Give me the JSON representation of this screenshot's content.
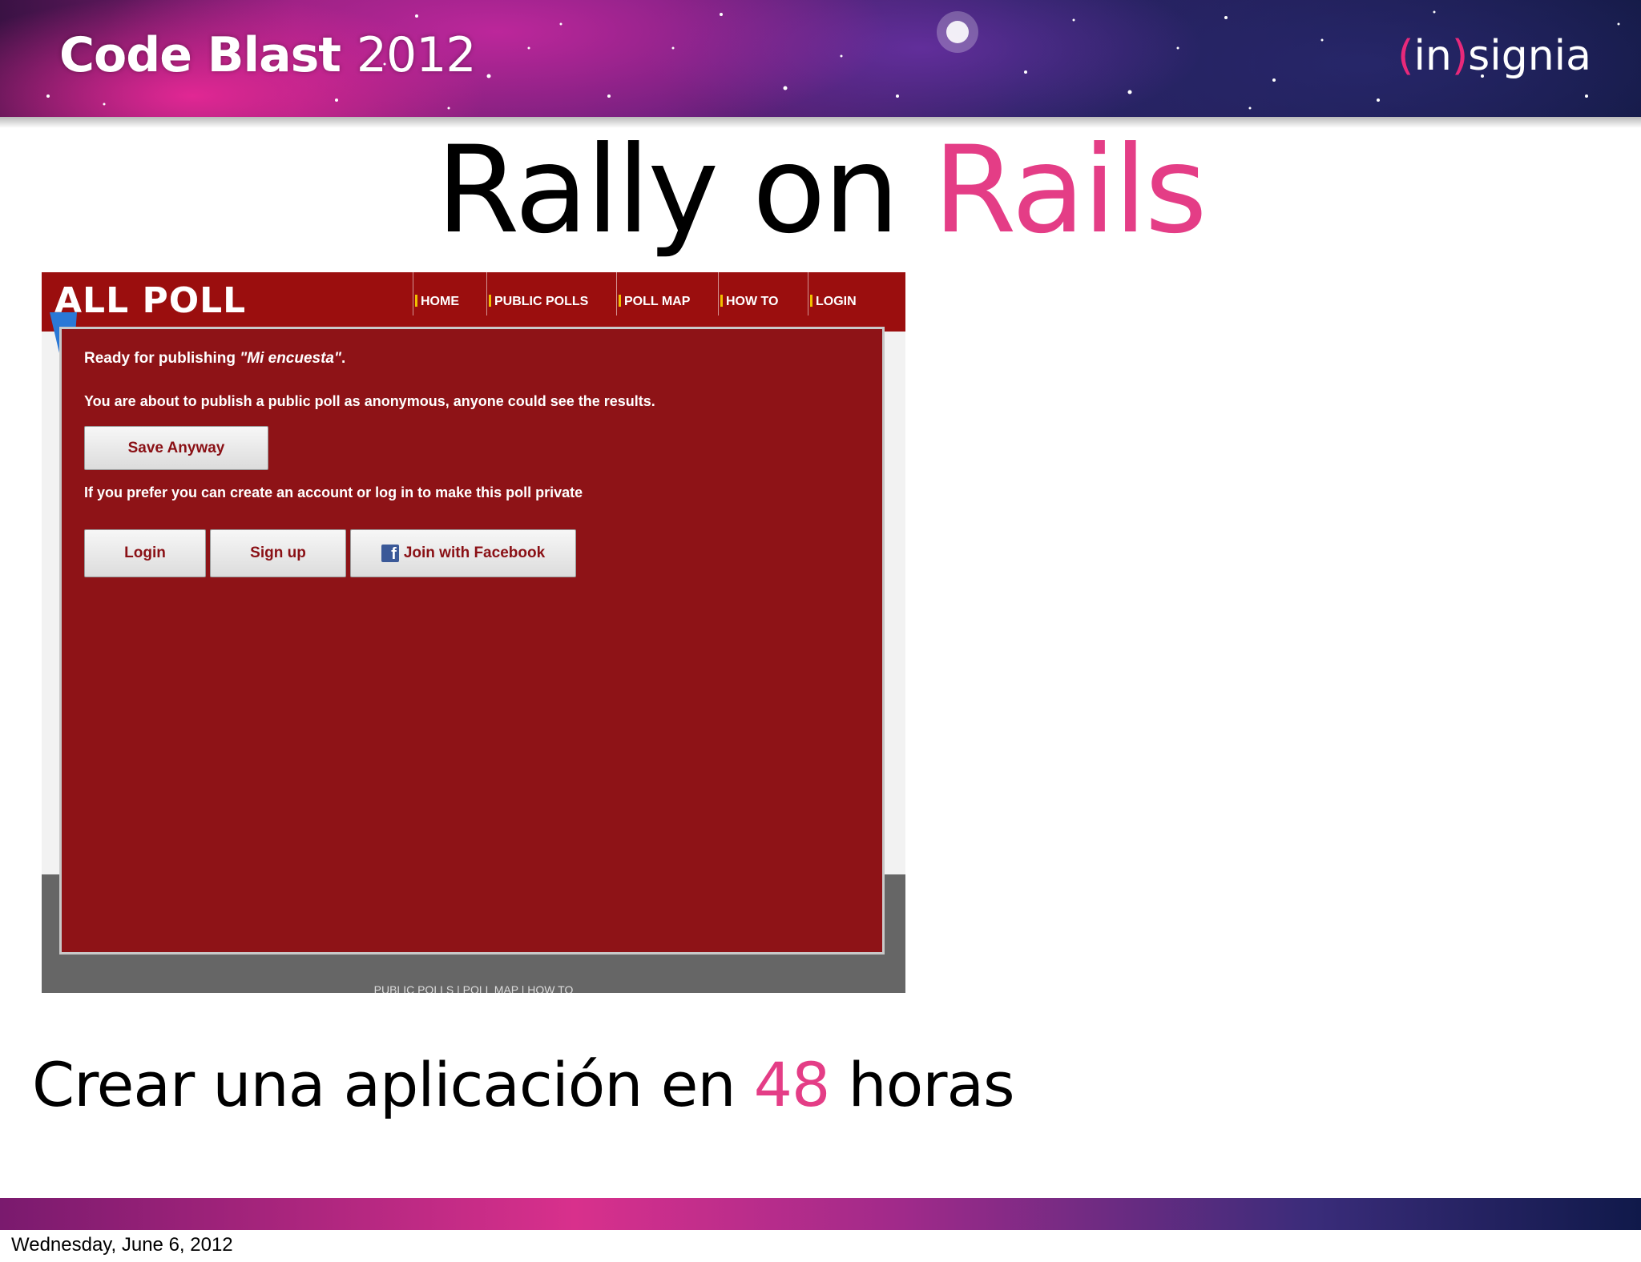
{
  "banner": {
    "title": "Code Blast",
    "year": "2012",
    "logo_paren_open": "(",
    "logo_in": "in",
    "logo_paren_close": ")",
    "logo_rest": "signia"
  },
  "slide": {
    "title_part1": "Rally on ",
    "title_part2": "Rails"
  },
  "app": {
    "logo": "ALL POLL",
    "nav": [
      "HOME",
      "PUBLIC POLLS",
      "POLL MAP",
      "HOW TO",
      "LOGIN"
    ],
    "ready_prefix": "Ready for publishing ",
    "poll_name": "\"Mi encuesta\"",
    "ready_suffix": ".",
    "anonymous_warning": "You are about to publish a public poll as anonymous, anyone could see the results.",
    "save_anyway_label": "Save Anyway",
    "private_hint": "If you prefer you can create an account or log in to make this poll private",
    "login_label": "Login",
    "signup_label": "Sign up",
    "facebook_label": "Join with Facebook",
    "footer_links": "PUBLIC POLLS | POLL MAP | HOW TO"
  },
  "caption": {
    "part1": "Crear una aplicación en ",
    "number": "48",
    "part2": " horas"
  },
  "date": "Wednesday, June 6, 2012",
  "colors": {
    "accent_pink": "#e43d86",
    "app_red": "#8e1317",
    "header_red": "#9b0e0e"
  }
}
